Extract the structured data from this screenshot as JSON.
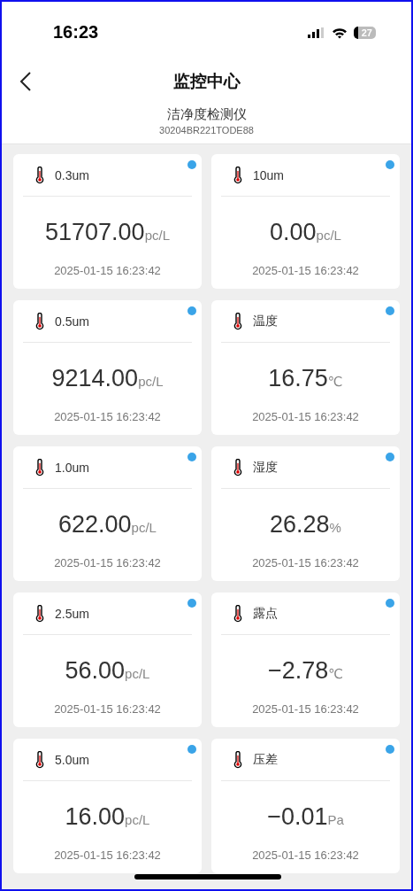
{
  "status_bar": {
    "time": "16:23",
    "battery": "27"
  },
  "nav": {
    "title": "监控中心"
  },
  "device": {
    "name": "洁净度检测仪",
    "serial": "30204BR221TODE88"
  },
  "sensors": [
    {
      "label": "0.3um",
      "value": "51707.00",
      "unit": "pc/L",
      "time": "2025-01-15 16:23:42"
    },
    {
      "label": "10um",
      "value": "0.00",
      "unit": "pc/L",
      "time": "2025-01-15 16:23:42"
    },
    {
      "label": "0.5um",
      "value": "9214.00",
      "unit": "pc/L",
      "time": "2025-01-15 16:23:42"
    },
    {
      "label": "温度",
      "value": "16.75",
      "unit": "℃",
      "time": "2025-01-15 16:23:42"
    },
    {
      "label": "1.0um",
      "value": "622.00",
      "unit": "pc/L",
      "time": "2025-01-15 16:23:42"
    },
    {
      "label": "湿度",
      "value": "26.28",
      "unit": "%",
      "time": "2025-01-15 16:23:42"
    },
    {
      "label": "2.5um",
      "value": "56.00",
      "unit": "pc/L",
      "time": "2025-01-15 16:23:42"
    },
    {
      "label": "露点",
      "value": "−2.78",
      "unit": "℃",
      "time": "2025-01-15 16:23:42"
    },
    {
      "label": "5.0um",
      "value": "16.00",
      "unit": "pc/L",
      "time": "2025-01-15 16:23:42"
    },
    {
      "label": "压差",
      "value": "−0.01",
      "unit": "Pa",
      "time": "2025-01-15 16:23:42"
    }
  ]
}
